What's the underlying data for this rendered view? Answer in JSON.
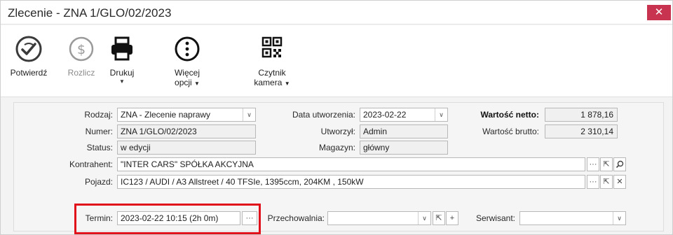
{
  "window": {
    "title": "Zlecenie - ZNA 1/GLO/02/2023",
    "close_label": "✕"
  },
  "ribbon": {
    "confirm_label": "Potwierdź",
    "settle_label": "Rozlicz",
    "print_label": "Drukuj",
    "more_label_1": "Więcej",
    "more_label_2": "opcji",
    "reader_label_1": "Czytnik",
    "reader_label_2": "kamera",
    "dropdown_arrow": "▼"
  },
  "form": {
    "rodzaj_label": "Rodzaj:",
    "rodzaj_value": "ZNA - Zlecenie naprawy",
    "numer_label": "Numer:",
    "numer_value": "ZNA 1/GLO/02/2023",
    "status_label": "Status:",
    "status_value": "w edycji",
    "data_utw_label": "Data utworzenia:",
    "data_utw_value": "2023-02-22",
    "utworzyl_label": "Utworzył:",
    "utworzyl_value": "Admin",
    "magazyn_label": "Magazyn:",
    "magazyn_value": "główny",
    "netto_label": "Wartość netto:",
    "netto_value": "1 878,16",
    "brutto_label": "Wartość brutto:",
    "brutto_value": "2 310,14",
    "kontrahent_label": "Kontrahent:",
    "kontrahent_value": "\"INTER CARS\" SPÓŁKA AKCYJNA",
    "pojazd_label": "Pojazd:",
    "pojazd_value": "IC123 / AUDI / A3 Allstreet / 40 TFSIe, 1395ccm, 204KM , 150kW",
    "termin_label": "Termin:",
    "termin_value": "2023-02-22 10:15 (2h 0m)",
    "przechowalnia_label": "Przechowalnia:",
    "przechowalnia_value": "",
    "serwisant_label": "Serwisant:",
    "serwisant_value": ""
  },
  "glyphs": {
    "chevron": "∨",
    "ellipsis": "···",
    "plus": "+",
    "cross": "✕",
    "jump": "⇱"
  }
}
